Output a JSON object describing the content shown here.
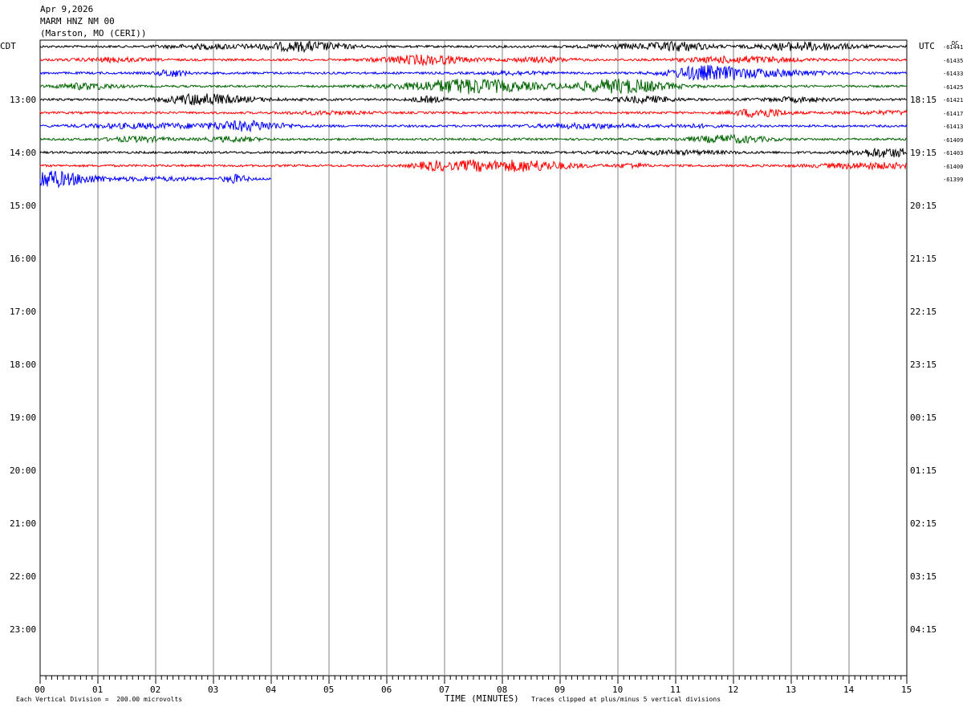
{
  "header": {
    "date": "Apr 9,2026",
    "station": "MARM HNZ NM 00",
    "location": "(Marston, MO (CERI))"
  },
  "axes": {
    "left_label": "CDT",
    "right_label": "UTC",
    "dc_label": "DC",
    "xlabel": "TIME (MINUTES)",
    "footer_left": "Each Vertical Division =  200.00 microvolts",
    "footer_right": "Traces clipped at plus/minus 5 vertical divisions"
  },
  "chart_data": {
    "type": "line",
    "title": "",
    "xlabel": "TIME (MINUTES)",
    "xlim": [
      0,
      15
    ],
    "x_ticks": [
      "00",
      "01",
      "02",
      "03",
      "04",
      "05",
      "06",
      "07",
      "08",
      "09",
      "10",
      "11",
      "12",
      "13",
      "14",
      "15"
    ],
    "left_hour_labels": [
      "13:00",
      "14:00",
      "15:00",
      "16:00",
      "17:00",
      "18:00",
      "19:00",
      "20:00",
      "21:00",
      "22:00",
      "23:00"
    ],
    "right_hour_labels": [
      "18:15",
      "19:15",
      "20:15",
      "21:15",
      "22:15",
      "23:15",
      "00:15",
      "01:15",
      "02:15",
      "03:15",
      "04:15"
    ],
    "trace_colors": [
      "#000000",
      "#ff0000",
      "#0000ff",
      "#006400"
    ],
    "traces": [
      {
        "dc": "-61441",
        "end_minute": 15
      },
      {
        "dc": "-61435",
        "end_minute": 15
      },
      {
        "dc": "-61433",
        "end_minute": 15
      },
      {
        "dc": "-61425",
        "end_minute": 15
      },
      {
        "dc": "-61421",
        "end_minute": 15
      },
      {
        "dc": "-61417",
        "end_minute": 15
      },
      {
        "dc": "-61413",
        "end_minute": 15
      },
      {
        "dc": "-61409",
        "end_minute": 15
      },
      {
        "dc": "-61403",
        "end_minute": 15
      },
      {
        "dc": "-61400",
        "end_minute": 15
      },
      {
        "dc": "-61399",
        "end_minute": 4
      }
    ]
  }
}
